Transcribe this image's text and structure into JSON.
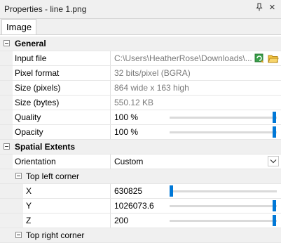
{
  "window": {
    "title": "Properties - line 1.png"
  },
  "title_controls": {
    "pin": "‣",
    "close": "×"
  },
  "tabs": [
    {
      "label": "Image"
    }
  ],
  "sections": {
    "general": {
      "label": "General",
      "rows": [
        {
          "name": "Input file",
          "value": "C:\\Users\\HeatherRose\\Downloads\\..."
        },
        {
          "name": "Pixel format",
          "value": "32 bits/pixel (BGRA)"
        },
        {
          "name": "Size (pixels)",
          "value": "864 wide x 163 high"
        },
        {
          "name": "Size (bytes)",
          "value": "550.12 KB"
        },
        {
          "name": "Quality",
          "value": "100 %",
          "level": 1.0
        },
        {
          "name": "Opacity",
          "value": "100 %",
          "level": 1.0
        }
      ]
    },
    "spatial": {
      "label": "Spatial Extents",
      "orientation": {
        "name": "Orientation",
        "value": "Custom"
      },
      "top_left": {
        "label": "Top left corner",
        "rows": [
          {
            "name": "X",
            "value": "630825",
            "level": 0.0
          },
          {
            "name": "Y",
            "value": "1026073.6",
            "level": 1.0
          },
          {
            "name": "Z",
            "value": "200",
            "level": 1.0
          }
        ]
      },
      "top_right": {
        "label": "Top right corner"
      }
    }
  },
  "colors": {
    "accent": "#0078d7",
    "readonly_text": "#7a7a7a",
    "gutter": "#f0f0f0"
  }
}
